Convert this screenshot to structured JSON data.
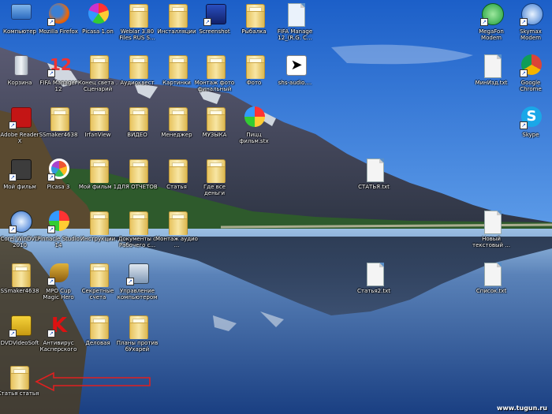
{
  "desktop": {
    "watermark": "www.tugun.ru",
    "icons": [
      {
        "label": "Компьютер",
        "type": "computer"
      },
      {
        "label": "Mozilla Firefox",
        "type": "firefox"
      },
      {
        "label": "Picasa 1.on",
        "type": "picasa"
      },
      {
        "label": "Weblar 3.80 Files RUS S...",
        "type": "folder"
      },
      {
        "label": "Инсталляции",
        "type": "folder"
      },
      {
        "label": "Screenshot",
        "type": "blue"
      },
      {
        "label": "Рыбалка",
        "type": "folder"
      },
      {
        "label": "FIFA Manage 12_(R.G. C...",
        "type": "doc"
      },
      {
        "label": "MegaFon Modem",
        "type": "megafon"
      },
      {
        "label": "Skymax Modem",
        "type": "skymax"
      },
      {
        "label": "Корзина",
        "type": "recycle"
      },
      {
        "label": "FIFA Manager 12",
        "type": "fifa"
      },
      {
        "label": "Конец света . Сценарий",
        "type": "folder"
      },
      {
        "label": "Аудиоквест",
        "type": "folder"
      },
      {
        "label": "Картинки",
        "type": "folder"
      },
      {
        "label": "Монтаж фото финальный",
        "type": "folder"
      },
      {
        "label": "Фото",
        "type": "folder"
      },
      {
        "label": "shs-audio....",
        "type": "cursor"
      },
      {
        "label": "МинИзд.txt",
        "type": "doc"
      },
      {
        "label": "Google Chrome",
        "type": "chrome"
      },
      {
        "label": "Adobe Reader X",
        "type": "acrobat"
      },
      {
        "label": "SSmaker4638",
        "type": "folder"
      },
      {
        "label": "IrfanView",
        "type": "folder"
      },
      {
        "label": "ВИДЕО",
        "type": "folder"
      },
      {
        "label": "Менеджер",
        "type": "folder"
      },
      {
        "label": "МУЗЫКА",
        "type": "folder"
      },
      {
        "label": "Пицц фильм.stx",
        "type": "pinwheel"
      },
      {
        "label": "Skype",
        "type": "skype"
      },
      {
        "label": "Мой фильм",
        "type": "film"
      },
      {
        "label": "Picasa 3",
        "type": "picasa3"
      },
      {
        "label": "Мой фильм 1",
        "type": "folder"
      },
      {
        "label": "ДЛЯ ОТЧЕТОВ",
        "type": "folder"
      },
      {
        "label": "Статья",
        "type": "folder"
      },
      {
        "label": "Где все деньги",
        "type": "folder"
      },
      {
        "label": "СТАТЬЯ.txt",
        "type": "doc"
      },
      {
        "label": "Corel WinDVD 2010",
        "type": "windvd"
      },
      {
        "label": "Pinnacle Studio 14",
        "type": "pinwheel"
      },
      {
        "label": "Инструкции",
        "type": "folder"
      },
      {
        "label": "Документы с Рабочего с...",
        "type": "folder"
      },
      {
        "label": "Монтаж аудио ...",
        "type": "folder"
      },
      {
        "label": "Новый текстовый ...",
        "type": "doc"
      },
      {
        "label": "SSmaker4638",
        "type": "folder"
      },
      {
        "label": "MPO Cup Magic Hero",
        "type": "dragon"
      },
      {
        "label": "Секретные счета",
        "type": "folder"
      },
      {
        "label": "Управление компьютером",
        "type": "manage"
      },
      {
        "label": "Статья2.txt",
        "type": "doc"
      },
      {
        "label": "Список.txt",
        "type": "doc"
      },
      {
        "label": "DVDVideoSoft",
        "type": "dvdsoft"
      },
      {
        "label": "Антивирус Касперского",
        "type": "kaspersky"
      },
      {
        "label": "Деловая",
        "type": "folder"
      },
      {
        "label": "Планы против бУхарей",
        "type": "folder"
      },
      {
        "label": "Статья статья",
        "type": "folder"
      }
    ]
  }
}
